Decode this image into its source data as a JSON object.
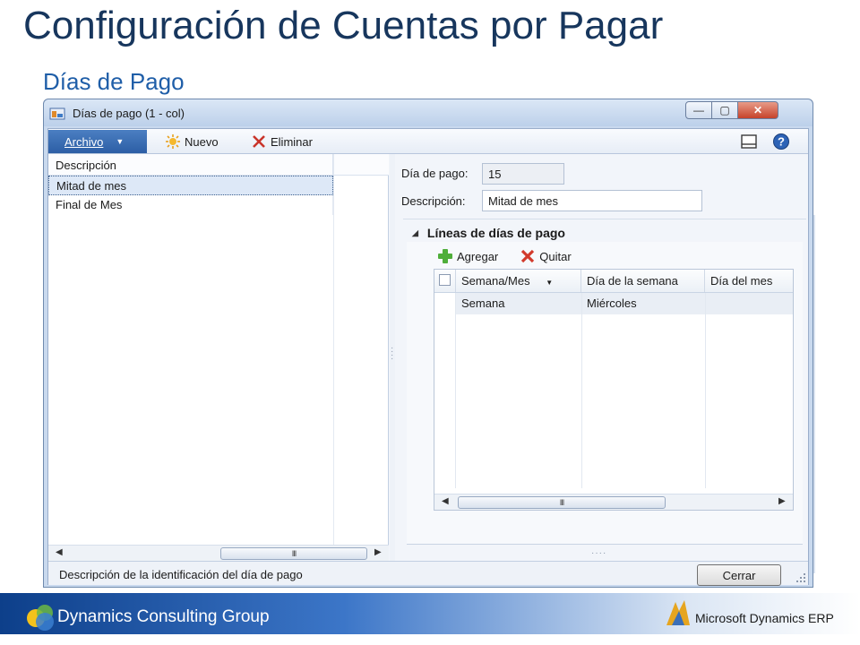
{
  "slide": {
    "title": "Configuración de Cuentas por Pagar",
    "subtitle": "Días de Pago"
  },
  "window": {
    "title": "Días de pago (1 - col)",
    "controls": {
      "minimize": "—",
      "maximize": "▢",
      "close": "✕"
    }
  },
  "toolbar": {
    "archivo_label": "Archivo",
    "archivo_arrow": "▼",
    "nuevo_label": "Nuevo",
    "eliminar_label": "Eliminar"
  },
  "list": {
    "header": "Descripción",
    "rows": [
      "Mitad de mes",
      "Final de Mes"
    ],
    "selected_index": 0
  },
  "form": {
    "dia_pago_label": "Día de pago:",
    "dia_pago_value": "15",
    "descripcion_label": "Descripción:",
    "descripcion_value": "Mitad de mes"
  },
  "section": {
    "title": "Líneas de días de pago",
    "toggle": "◢",
    "agregar_label": "Agregar",
    "quitar_label": "Quitar"
  },
  "grid": {
    "columns": [
      "Semana/Mes",
      "Día de la semana",
      "Día del mes"
    ],
    "sort_arrow": "▼",
    "rows": [
      {
        "semana_mes": "Semana",
        "dia_semana": "Miércoles",
        "dia_mes": ""
      }
    ]
  },
  "scroll": {
    "left_arrow": "◀",
    "right_arrow": "▶",
    "thumb": "III"
  },
  "statusbar": {
    "text": "Descripción de la identificación del día de pago",
    "close_label": "Cerrar"
  },
  "footer": {
    "company": "Dynamics Consulting Group",
    "brand": "Microsoft Dynamics ERP"
  },
  "colors": {
    "title": "#17365d",
    "subtitle": "#1f5ea8",
    "archivo_button": "#2c5ea5",
    "footer": "#0d3f8a"
  }
}
